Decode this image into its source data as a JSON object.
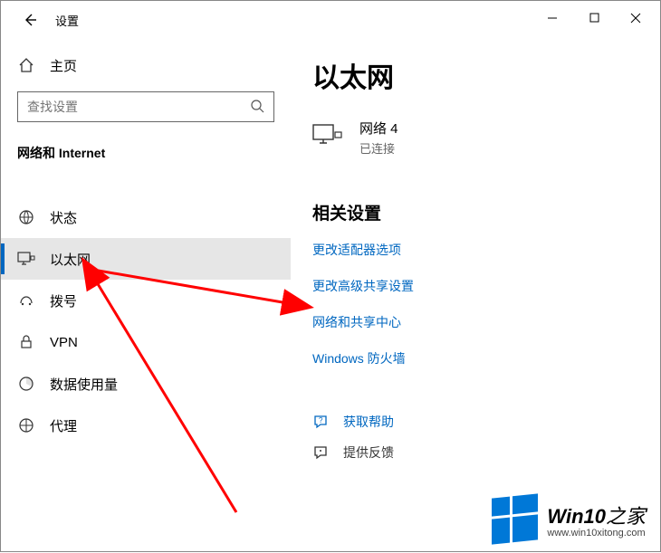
{
  "window": {
    "title": "设置"
  },
  "sidebar": {
    "home_label": "主页",
    "search_placeholder": "查找设置",
    "section": "网络和 Internet",
    "items": [
      {
        "label": "状态"
      },
      {
        "label": "以太网"
      },
      {
        "label": "拨号"
      },
      {
        "label": "VPN"
      },
      {
        "label": "数据使用量"
      },
      {
        "label": "代理"
      }
    ]
  },
  "content": {
    "heading": "以太网",
    "network": {
      "name": "网络 4",
      "status": "已连接"
    },
    "related_heading": "相关设置",
    "links": [
      "更改适配器选项",
      "更改高级共享设置",
      "网络和共享中心",
      "Windows 防火墙"
    ],
    "help": "获取帮助",
    "feedback": "提供反馈"
  },
  "watermark": {
    "brand_prefix": "Win10",
    "brand_suffix": "之家",
    "url": "www.win10xitong.com"
  }
}
